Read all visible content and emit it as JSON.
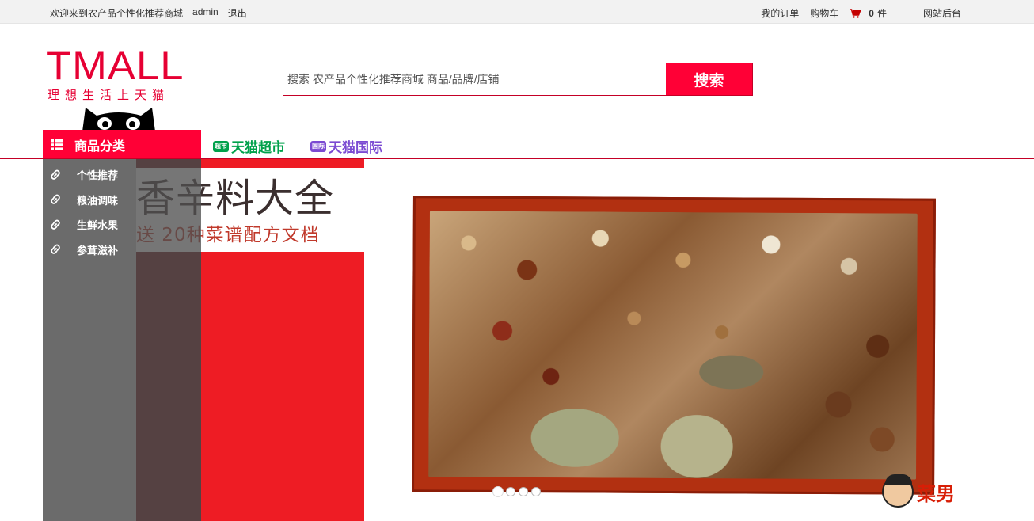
{
  "topbar": {
    "welcome": "欢迎来到农产品个性化推荐商城",
    "username": "admin",
    "logout": "退出",
    "my_orders": "我的订单",
    "cart": "购物车",
    "cart_count": "0",
    "cart_unit": "件",
    "admin_site": "网站后台"
  },
  "header": {
    "logo_word": "TMALL",
    "logo_slogan": "理想生活上天猫",
    "search_placeholder": "搜索 农产品个性化推荐商城 商品/品牌/店铺",
    "search_button": "搜索"
  },
  "nav": {
    "category_title": "商品分类",
    "links": [
      {
        "label": "天猫超市",
        "tag": "超市",
        "color": "#00a14b"
      },
      {
        "label": "天猫国际",
        "tag": "国际",
        "color": "#7b4ad2"
      }
    ]
  },
  "categories": [
    {
      "label": "个性推荐"
    },
    {
      "label": "粮油调味"
    },
    {
      "label": "生鲜水果"
    },
    {
      "label": "参茸滋补"
    }
  ],
  "banner": {
    "title": "香辛料大全",
    "subtitle": "送 20种菜谱配方文档",
    "mascot_text": "菜男",
    "slides": 4,
    "active_slide": 1
  },
  "colors": {
    "brand_red": "#ff0036",
    "dark_red": "#c40026"
  }
}
